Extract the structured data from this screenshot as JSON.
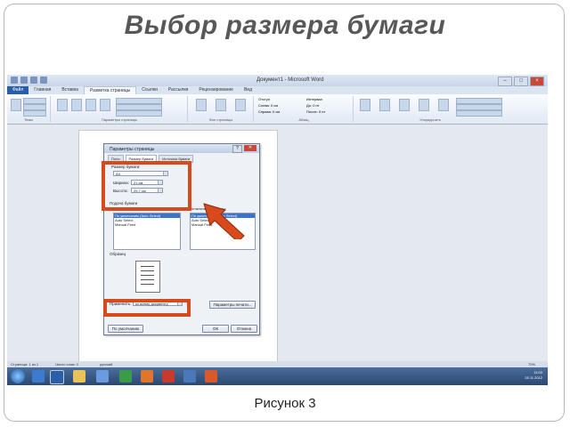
{
  "slide": {
    "title": "Выбор размера бумаги",
    "caption": "Рисунок 3"
  },
  "window": {
    "title": "Документ1 - Microsoft Word",
    "controls": [
      "–",
      "□",
      "×"
    ]
  },
  "ribbon": {
    "tabs": [
      "Файл",
      "Главная",
      "Вставка",
      "Разметка страницы",
      "Ссылки",
      "Рассылки",
      "Рецензирование",
      "Вид"
    ],
    "active_tab": "Разметка страницы",
    "groups": [
      "Темы",
      "Параметры страницы",
      "Фон страницы",
      "Абзац",
      "Упорядочить"
    ],
    "indent_label": "Отступ",
    "spacing_label": "Интервал",
    "indent_left": "Слева: 0 см",
    "indent_right": "Справа: 0 см",
    "spacing_before": "До: 0 пт",
    "spacing_after": "После: 0 пт"
  },
  "dialog": {
    "title": "Параметры страницы",
    "tabs": [
      "Поля",
      "Размер бумаги",
      "Источник бумаги"
    ],
    "paper_size_label": "Размер бумаги:",
    "paper_size_value": "A4",
    "width_label": "Ширина:",
    "width_value": "21 см",
    "height_label": "Высота:",
    "height_value": "29,7 см",
    "paper_source_label": "Подача бумаги",
    "first_page_label": "Первая страница:",
    "other_pages_label": "Остальные страницы:",
    "source_items_left": [
      "По умолчанию (Auto Select)",
      "Auto Select",
      "Manual Feed"
    ],
    "source_items_right": [
      "По умолчанию (Auto Select)",
      "Auto Select",
      "Manual Feed"
    ],
    "preview_label": "Образец",
    "apply_label": "Применить:",
    "apply_value": "ко всему документу",
    "print_options_button": "Параметры печати...",
    "default_button": "По умолчанию",
    "ok_button": "ОК",
    "cancel_button": "Отмена"
  },
  "statusbar": {
    "page": "Страница: 1 из 1",
    "words": "Число слов: 0",
    "language": "русский",
    "zoom": "70%"
  },
  "taskbar": {
    "time": "11:03",
    "date": "28.11.2012"
  },
  "colors": {
    "highlight": "#d84a1b",
    "title_gray": "#585858",
    "file_tab": "#2a5ea8"
  }
}
